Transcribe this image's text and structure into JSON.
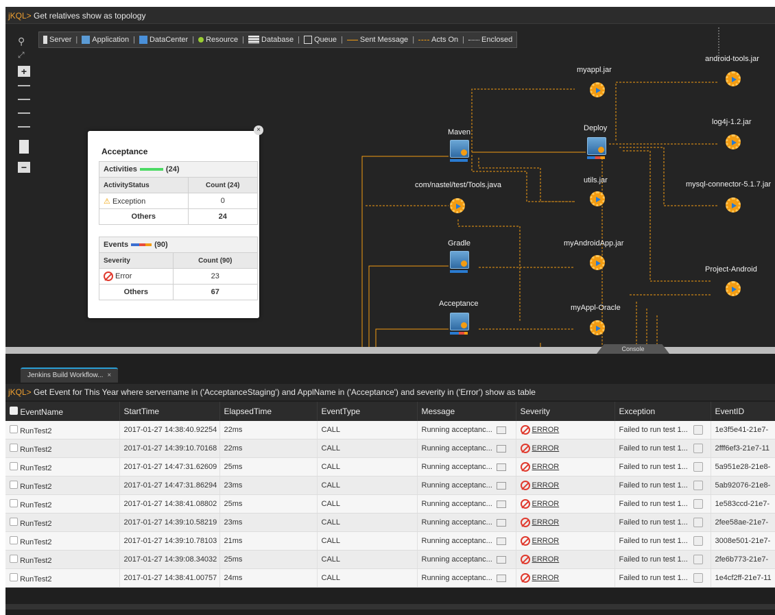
{
  "topology": {
    "jkql_prefix": "jKQL>",
    "query": "Get relatives show as topology",
    "legend": [
      {
        "label": "Server",
        "icon": "server-icon"
      },
      {
        "label": "Application",
        "icon": "application-icon"
      },
      {
        "label": "DataCenter",
        "icon": "datacenter-icon"
      },
      {
        "label": "Resource",
        "icon": "resource-icon"
      },
      {
        "label": "Database",
        "icon": "database-icon"
      },
      {
        "label": "Queue",
        "icon": "queue-icon"
      },
      {
        "label": "Sent Message",
        "icon": "solid-line-icon"
      },
      {
        "label": "Acts On",
        "icon": "dashed-line-icon"
      },
      {
        "label": "Enclosed",
        "icon": "dotted-line-icon"
      }
    ],
    "zoom": {
      "plus": "+",
      "minus": "−"
    },
    "nodes": {
      "maven": "Maven",
      "deploy": "Deploy",
      "tools_java": "com/nastel/test/Tools.java",
      "utils_jar": "utils.jar",
      "gradle": "Gradle",
      "myandroidapp_jar": "myAndroidApp.jar",
      "acceptance": "Acceptance",
      "myappl_oracle": "myAppl-Oracle",
      "myappl_jar": "myappl.jar",
      "android_tools_jar": "android-tools.jar",
      "log4j_jar": "log4j-1.2.jar",
      "mysql_connector": "mysql-connector-5.1.7.jar",
      "project_android": "Project-Android"
    },
    "popup": {
      "title": "Acceptance",
      "close": "×",
      "activities": {
        "label": "Activities",
        "count": "(24)",
        "col1": "ActivityStatus",
        "col2": "Count (24)",
        "rows": [
          {
            "name": "Exception",
            "value": "0"
          },
          {
            "name": "Others",
            "value": "24"
          }
        ]
      },
      "events": {
        "label": "Events",
        "count": "(90)",
        "col1": "Severity",
        "col2": "Count (90)",
        "rows": [
          {
            "name": "Error",
            "value": "23"
          },
          {
            "name": "Others",
            "value": "67"
          }
        ]
      }
    },
    "console_tab": "Console"
  },
  "lower": {
    "tab_label": "Jenkins Build Workflow...",
    "tab_close": "×",
    "jkql_prefix": "jKQL>",
    "query": "Get Event for This Year where servername in ('AcceptanceStaging') and ApplName in ('Acceptance') and severity in ('Error') show as table",
    "columns": [
      "EventName",
      "StartTime",
      "ElapsedTime",
      "EventType",
      "Message",
      "Severity",
      "Exception",
      "EventID"
    ],
    "rows": [
      {
        "name": "RunTest2",
        "start": "2017-01-27 14:38:40.92254",
        "elapsed": "22ms",
        "type": "CALL",
        "message": "Running acceptanc...",
        "severity": "ERROR",
        "exception": "Failed to run test 1...",
        "id": "1e3f5e41-21e7-"
      },
      {
        "name": "RunTest2",
        "start": "2017-01-27 14:39:10.70168",
        "elapsed": "22ms",
        "type": "CALL",
        "message": "Running acceptanc...",
        "severity": "ERROR",
        "exception": "Failed to run test 1...",
        "id": "2fff6ef3-21e7-11"
      },
      {
        "name": "RunTest2",
        "start": "2017-01-27 14:47:31.62609",
        "elapsed": "25ms",
        "type": "CALL",
        "message": "Running acceptanc...",
        "severity": "ERROR",
        "exception": "Failed to run test 1...",
        "id": "5a951e28-21e8-"
      },
      {
        "name": "RunTest2",
        "start": "2017-01-27 14:47:31.86294",
        "elapsed": "23ms",
        "type": "CALL",
        "message": "Running acceptanc...",
        "severity": "ERROR",
        "exception": "Failed to run test 1...",
        "id": "5ab92076-21e8-"
      },
      {
        "name": "RunTest2",
        "start": "2017-01-27 14:38:41.08802",
        "elapsed": "25ms",
        "type": "CALL",
        "message": "Running acceptanc...",
        "severity": "ERROR",
        "exception": "Failed to run test 1...",
        "id": "1e583ccd-21e7-"
      },
      {
        "name": "RunTest2",
        "start": "2017-01-27 14:39:10.58219",
        "elapsed": "23ms",
        "type": "CALL",
        "message": "Running acceptanc...",
        "severity": "ERROR",
        "exception": "Failed to run test 1...",
        "id": "2fee58ae-21e7-"
      },
      {
        "name": "RunTest2",
        "start": "2017-01-27 14:39:10.78103",
        "elapsed": "21ms",
        "type": "CALL",
        "message": "Running acceptanc...",
        "severity": "ERROR",
        "exception": "Failed to run test 1...",
        "id": "3008e501-21e7-"
      },
      {
        "name": "RunTest2",
        "start": "2017-01-27 14:39:08.34032",
        "elapsed": "25ms",
        "type": "CALL",
        "message": "Running acceptanc...",
        "severity": "ERROR",
        "exception": "Failed to run test 1...",
        "id": "2fe6b773-21e7-"
      },
      {
        "name": "RunTest2",
        "start": "2017-01-27 14:38:41.00757",
        "elapsed": "24ms",
        "type": "CALL",
        "message": "Running acceptanc...",
        "severity": "ERROR",
        "exception": "Failed to run test 1...",
        "id": "1e4cf2ff-21e7-11"
      }
    ]
  },
  "colors": {
    "jkql_accent": "#f0a030",
    "node_orange": "#f39c12",
    "error_red": "#e03a2e",
    "tab_accent": "#2a9fd6",
    "activities_bar": "#4cd964"
  }
}
